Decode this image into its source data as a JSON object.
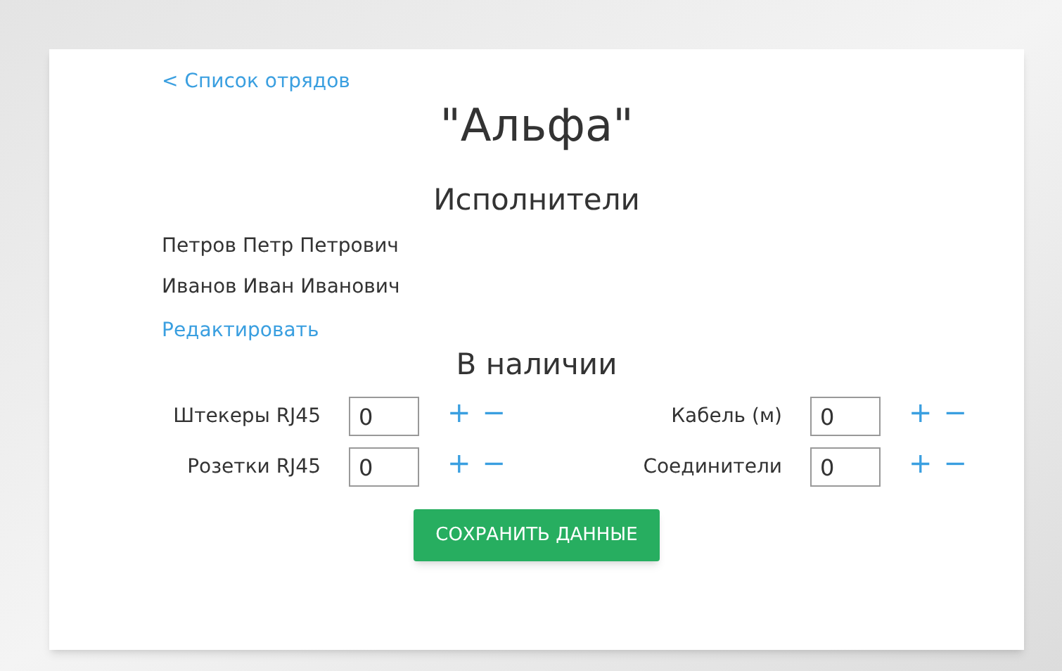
{
  "back_link": "< Список отрядов",
  "title": "\"Альфа\"",
  "performers": {
    "heading": "Исполнители",
    "names": [
      "Петров Петр Петрович",
      "Иванов Иван Иванович"
    ],
    "edit_link": "Редактировать"
  },
  "stock": {
    "heading": "В наличии",
    "items": [
      {
        "label": "Штекеры RJ45",
        "value": "0",
        "plus": "+",
        "minus": "−"
      },
      {
        "label": "Кабель (м)",
        "value": "0",
        "plus": "+",
        "minus": "−"
      },
      {
        "label": "Розетки RJ45",
        "value": "0",
        "plus": "+",
        "minus": "−"
      },
      {
        "label": "Соединители",
        "value": "0",
        "plus": "+",
        "minus": "−"
      }
    ]
  },
  "save_button": "СОХРАНИТЬ ДАННЫЕ"
}
